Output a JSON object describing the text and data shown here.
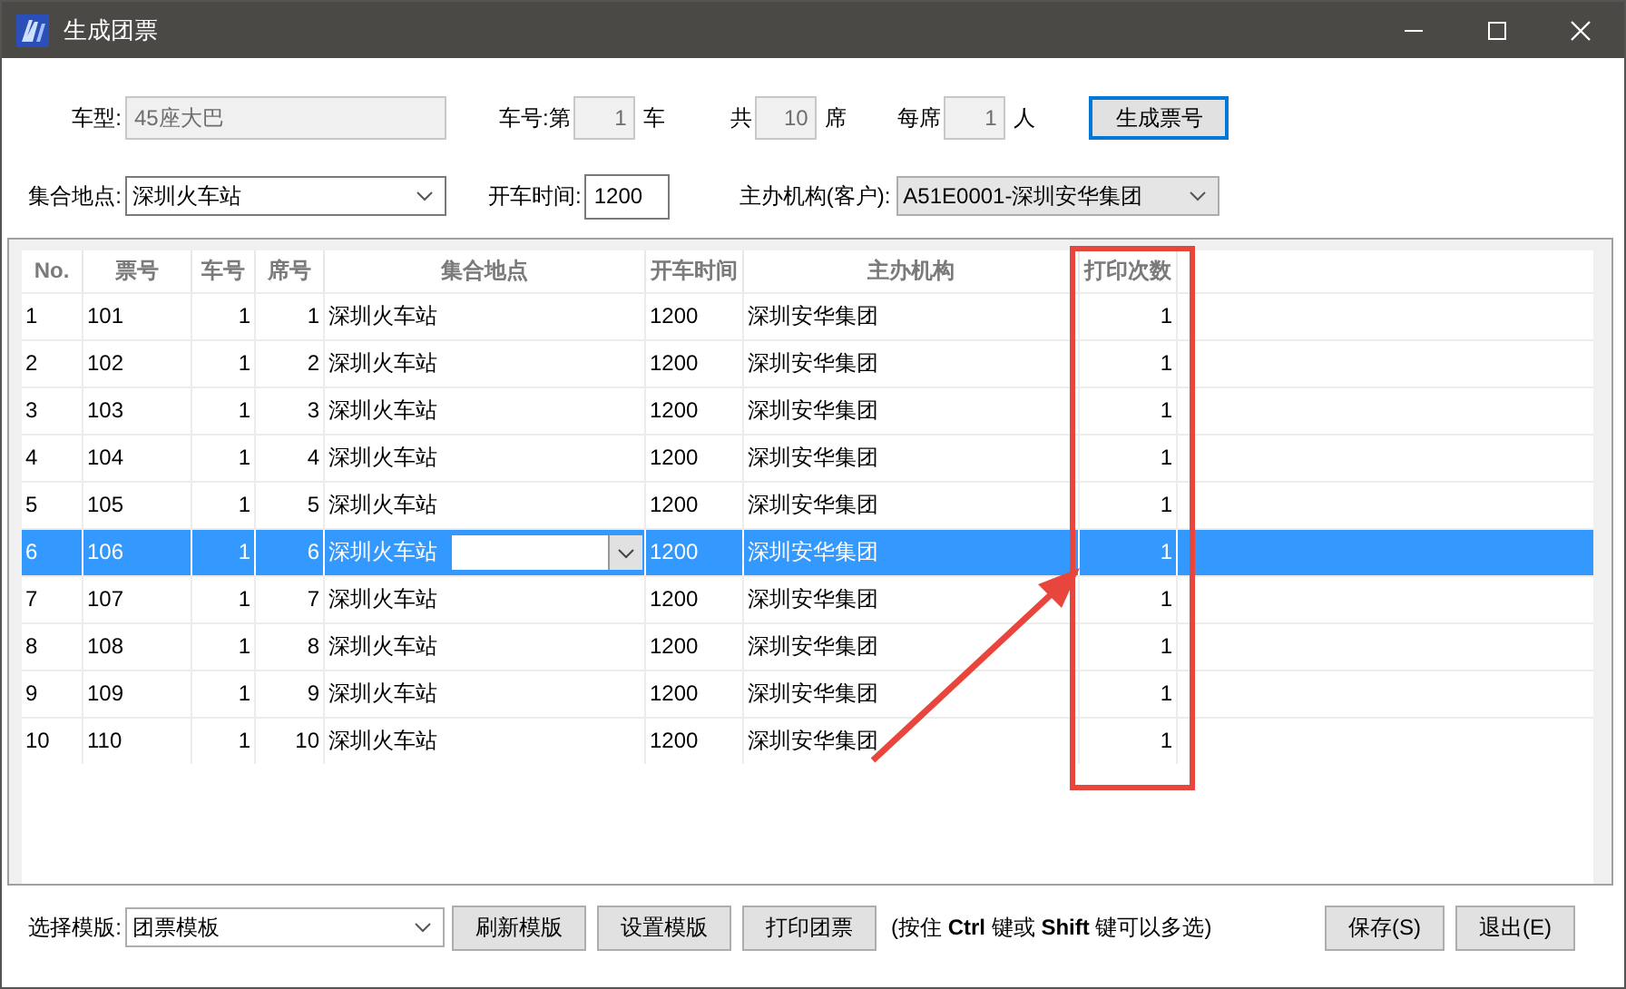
{
  "window": {
    "title": "生成团票"
  },
  "form": {
    "vehicle_type": {
      "label": "车型:",
      "value": "45座大巴"
    },
    "car_no": {
      "label": "车号:第",
      "value": "1",
      "unit": "车"
    },
    "total": {
      "label": "共",
      "value": "10",
      "unit": "席"
    },
    "per_seat": {
      "label": "每席",
      "value": "1",
      "unit": "人"
    },
    "generate_button": "生成票号",
    "meeting_point": {
      "label": "集合地点:",
      "value": "深圳火车站"
    },
    "departure_time": {
      "label": "开车时间:",
      "value": "1200"
    },
    "organizer": {
      "label": "主办机构(客户):",
      "value": "A51E0001-深圳安华集团"
    }
  },
  "table": {
    "columns": [
      "No.",
      "票号",
      "车号",
      "席号",
      "集合地点",
      "开车时间",
      "主办机构",
      "打印次数"
    ],
    "rows": [
      {
        "cells": [
          "1",
          "101",
          "1",
          "1",
          "深圳火车站",
          "1200",
          "深圳安华集团",
          "1"
        ],
        "selected": false,
        "editing": false
      },
      {
        "cells": [
          "2",
          "102",
          "1",
          "2",
          "深圳火车站",
          "1200",
          "深圳安华集团",
          "1"
        ],
        "selected": false,
        "editing": false
      },
      {
        "cells": [
          "3",
          "103",
          "1",
          "3",
          "深圳火车站",
          "1200",
          "深圳安华集团",
          "1"
        ],
        "selected": false,
        "editing": false
      },
      {
        "cells": [
          "4",
          "104",
          "1",
          "4",
          "深圳火车站",
          "1200",
          "深圳安华集团",
          "1"
        ],
        "selected": false,
        "editing": false
      },
      {
        "cells": [
          "5",
          "105",
          "1",
          "5",
          "深圳火车站",
          "1200",
          "深圳安华集团",
          "1"
        ],
        "selected": false,
        "editing": false
      },
      {
        "cells": [
          "6",
          "106",
          "1",
          "6",
          "深圳火车站",
          "1200",
          "深圳安华集团",
          "1"
        ],
        "selected": true,
        "editing": true
      },
      {
        "cells": [
          "7",
          "107",
          "1",
          "7",
          "深圳火车站",
          "1200",
          "深圳安华集团",
          "1"
        ],
        "selected": false,
        "editing": false
      },
      {
        "cells": [
          "8",
          "108",
          "1",
          "8",
          "深圳火车站",
          "1200",
          "深圳安华集团",
          "1"
        ],
        "selected": false,
        "editing": false
      },
      {
        "cells": [
          "9",
          "109",
          "1",
          "9",
          "深圳火车站",
          "1200",
          "深圳安华集团",
          "1"
        ],
        "selected": false,
        "editing": false
      },
      {
        "cells": [
          "10",
          "110",
          "1",
          "10",
          "深圳火车站",
          "1200",
          "深圳安华集团",
          "1"
        ],
        "selected": false,
        "editing": false
      }
    ]
  },
  "footer": {
    "template": {
      "label": "选择模版:",
      "value": "团票模板"
    },
    "buttons": [
      "刷新模版",
      "设置模版",
      "打印团票"
    ],
    "hint": "(按住 **Ctrl** 键或 **Shift** 键可以多选)",
    "save_button": "保存(S)",
    "exit_button": "退出(E)"
  }
}
